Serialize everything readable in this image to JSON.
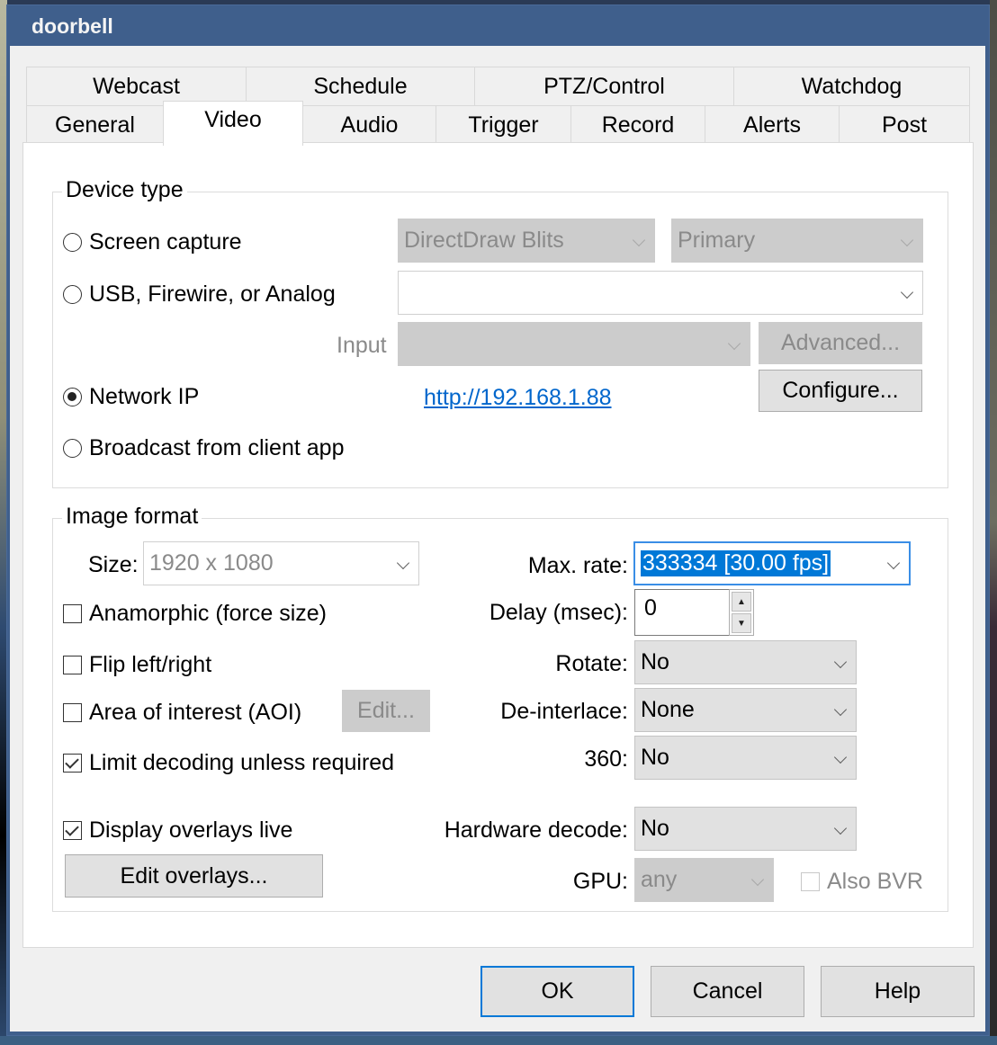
{
  "window": {
    "title": "doorbell"
  },
  "tabs": {
    "row1": [
      {
        "label": "Webcast"
      },
      {
        "label": "Schedule"
      },
      {
        "label": "PTZ/Control"
      },
      {
        "label": "Watchdog"
      }
    ],
    "row2": [
      {
        "label": "General"
      },
      {
        "label": "Video",
        "active": true
      },
      {
        "label": "Audio"
      },
      {
        "label": "Trigger"
      },
      {
        "label": "Record"
      },
      {
        "label": "Alerts"
      },
      {
        "label": "Post"
      }
    ]
  },
  "device_type": {
    "title": "Device type",
    "screen_capture": {
      "label": "Screen capture",
      "checked": false,
      "method": "DirectDraw Blits",
      "monitor": "Primary"
    },
    "usb": {
      "label": "USB, Firewire, or Analog",
      "checked": false,
      "device": ""
    },
    "input": {
      "label": "Input",
      "value": ""
    },
    "advanced_label": "Advanced...",
    "network_ip": {
      "label": "Network IP",
      "checked": true,
      "url": "http://192.168.1.88"
    },
    "configure_label": "Configure...",
    "broadcast": {
      "label": "Broadcast from client app",
      "checked": false
    }
  },
  "image_format": {
    "title": "Image format",
    "size": {
      "label": "Size:",
      "value": "1920 x 1080"
    },
    "anamorphic": {
      "label": "Anamorphic (force size)",
      "checked": false
    },
    "flip": {
      "label": "Flip left/right",
      "checked": false
    },
    "aoi": {
      "label": "Area of interest (AOI)",
      "checked": false,
      "edit_label": "Edit..."
    },
    "limit_decoding": {
      "label": "Limit decoding unless required",
      "checked": true
    },
    "display_overlays": {
      "label": "Display overlays live",
      "checked": true
    },
    "edit_overlays_label": "Edit overlays...",
    "max_rate": {
      "label": "Max. rate:",
      "value": "333334 [30.00 fps]"
    },
    "delay": {
      "label": "Delay (msec):",
      "value": "0"
    },
    "rotate": {
      "label": "Rotate:",
      "value": "No"
    },
    "deinterlace": {
      "label": "De-interlace:",
      "value": "None"
    },
    "three60": {
      "label": "360:",
      "value": "No"
    },
    "hardware_decode": {
      "label": "Hardware decode:",
      "value": "No"
    },
    "gpu": {
      "label": "GPU:",
      "value": "any"
    },
    "also_bvr": {
      "label": "Also BVR",
      "checked": false
    }
  },
  "footer": {
    "ok_label": "OK",
    "cancel_label": "Cancel",
    "help_label": "Help"
  }
}
